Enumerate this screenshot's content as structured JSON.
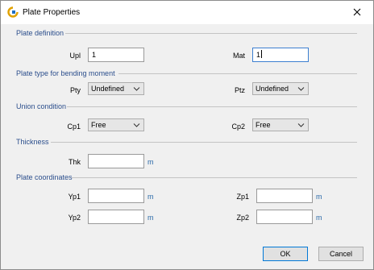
{
  "window": {
    "title": "Plate Properties"
  },
  "sections": {
    "plate_definition": "Plate definition",
    "plate_type": "Plate type for bending moment",
    "union": "Union condition",
    "thickness": "Thickness",
    "coordinates": "Plate coordinates"
  },
  "fields": {
    "upl": {
      "label": "Upl",
      "value": "1"
    },
    "mat": {
      "label": "Mat",
      "value": "1"
    },
    "pty": {
      "label": "Pty",
      "value": "Undefined"
    },
    "ptz": {
      "label": "Ptz",
      "value": "Undefined"
    },
    "cp1": {
      "label": "Cp1",
      "value": "Free"
    },
    "cp2": {
      "label": "Cp2",
      "value": "Free"
    },
    "thk": {
      "label": "Thk",
      "value": "",
      "unit": "m"
    },
    "yp1": {
      "label": "Yp1",
      "value": "",
      "unit": "m"
    },
    "zp1": {
      "label": "Zp1",
      "value": "",
      "unit": "m"
    },
    "yp2": {
      "label": "Yp2",
      "value": "",
      "unit": "m"
    },
    "zp2": {
      "label": "Zp2",
      "value": "",
      "unit": "m"
    }
  },
  "buttons": {
    "ok": "OK",
    "cancel": "Cancel"
  },
  "icons": {
    "app": "app-logo-icon",
    "close": "close-icon",
    "dropdown": "chevron-down-icon"
  },
  "colors": {
    "section_title": "#2b4e8c",
    "unit": "#2b6aa8",
    "focus_border": "#3c7fd0",
    "default_button_border": "#0078d7"
  }
}
